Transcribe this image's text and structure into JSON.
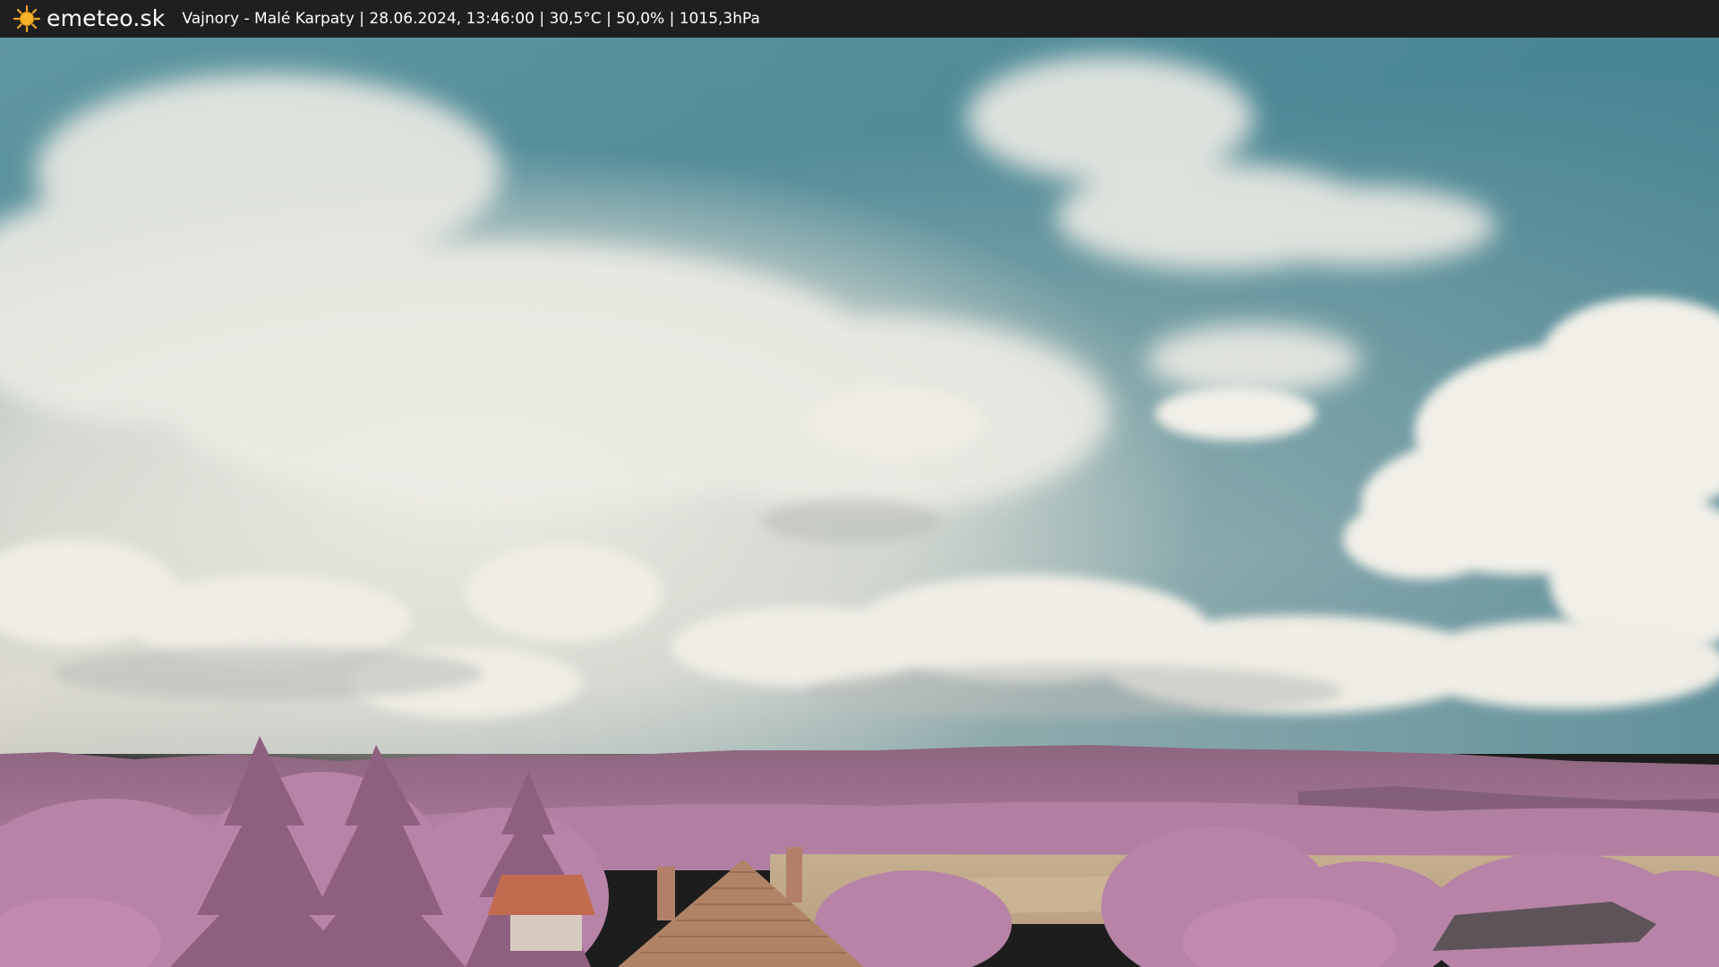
{
  "header": {
    "site_name": "emeteo.sk",
    "logo_icon": "sun-icon",
    "caption": "Vajnory - Malé Karpaty | 28.06.2024, 13:46:00 | 30,5°C | 50,0% | 1015,3hPa"
  },
  "colors": {
    "bar_background": "#1f1f1f",
    "bar_text": "#ffffff",
    "sun": "#f5a623",
    "sky_top": "#4f8c98",
    "cloud": "#eeeade",
    "hills": "#9a6a8a",
    "foliage": "#b781a7",
    "field": "#c9b391",
    "roof": "#bf6a4e"
  }
}
